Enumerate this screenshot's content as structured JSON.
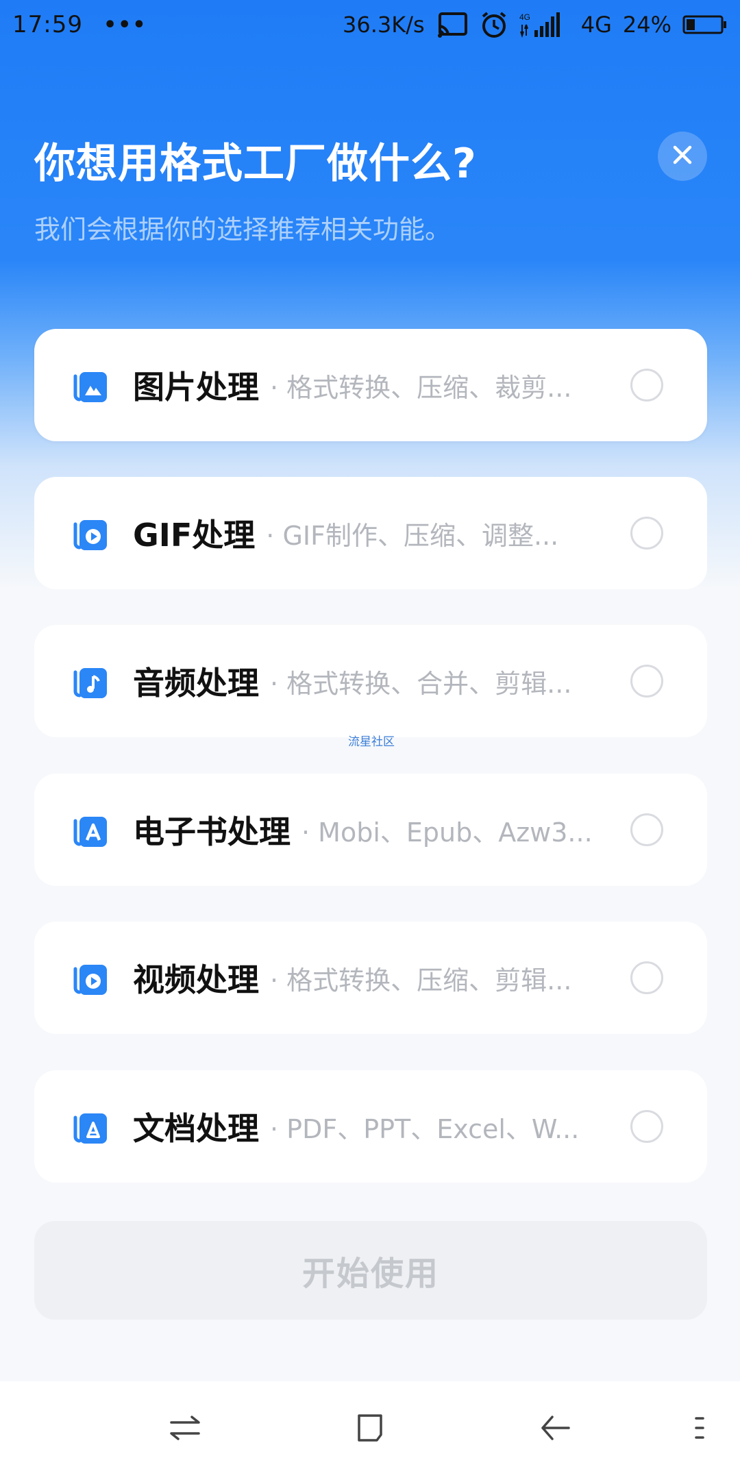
{
  "status_bar": {
    "time": "17:59",
    "dots": "•••",
    "speed": "36.3K/s",
    "network": "4G",
    "battery": "24%"
  },
  "header": {
    "title": "你想用格式工厂做什么?",
    "subtitle": "我们会根据你的选择推荐相关功能。"
  },
  "options": [
    {
      "title": "图片处理",
      "desc": "· 格式转换、压缩、裁剪...",
      "icon": "image-icon",
      "selected": true
    },
    {
      "title": "GIF处理",
      "desc": "· GIF制作、压缩、调整...",
      "icon": "gif-play-icon",
      "selected": false
    },
    {
      "title": "音频处理",
      "desc": "· 格式转换、合并、剪辑...",
      "icon": "music-note-icon",
      "selected": false
    },
    {
      "title": "电子书处理",
      "desc": "· Mobi、Epub、Azw3...",
      "icon": "ebook-icon",
      "selected": false
    },
    {
      "title": "视频处理",
      "desc": "· 格式转换、压缩、剪辑...",
      "icon": "video-play-icon",
      "selected": false
    },
    {
      "title": "文档处理",
      "desc": "· PDF、PPT、Excel、W...",
      "icon": "document-icon",
      "selected": false
    }
  ],
  "watermark": "流星社区",
  "start_button": "开始使用",
  "colors": {
    "primary": "#1f7cf6",
    "icon_blue": "#2b86f6",
    "text_dark": "#111111",
    "text_muted": "#b3b6bc",
    "disabled_bg": "#eef0f3"
  }
}
